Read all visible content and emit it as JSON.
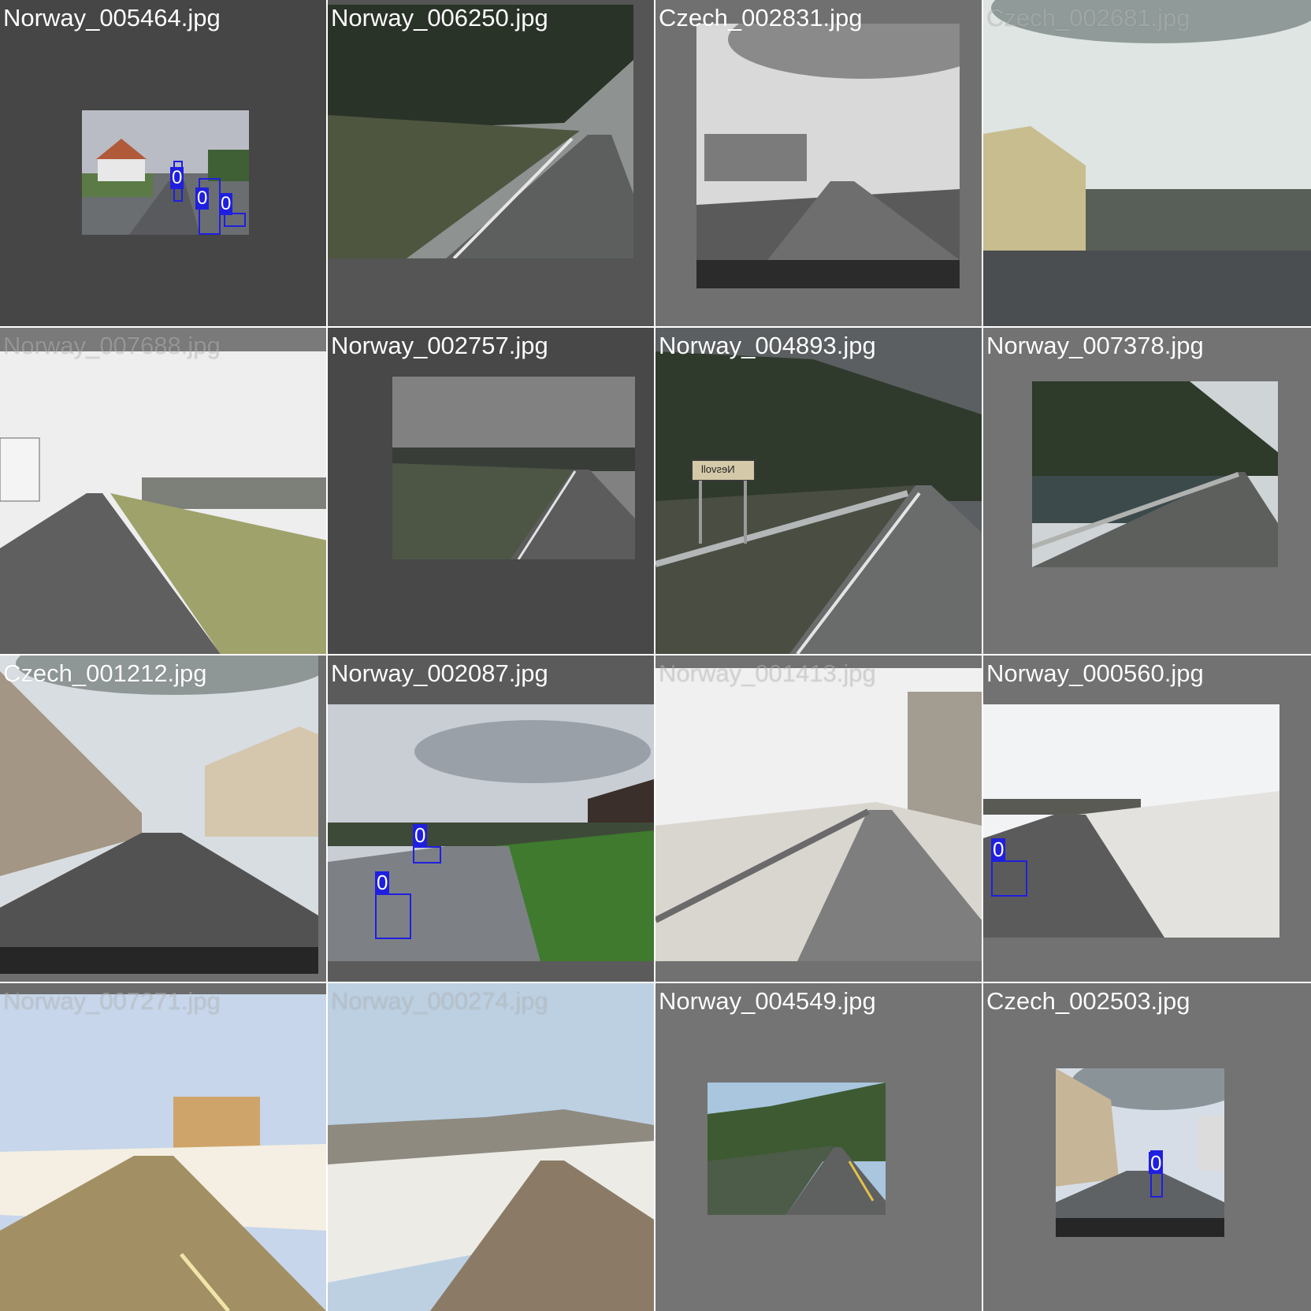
{
  "mosaic": {
    "tiles": [
      {
        "name": "Norway_005464.jpg",
        "class_label": "0"
      },
      {
        "name": "Norway_006250.jpg"
      },
      {
        "name": "Czech_002831.jpg"
      },
      {
        "name": "Czech_002681.jpg"
      },
      {
        "name": "Norway_007688.jpg"
      },
      {
        "name": "Norway_002757.jpg"
      },
      {
        "name": "Norway_004893.jpg",
        "sign_text": "Nesvoll"
      },
      {
        "name": "Norway_007378.jpg"
      },
      {
        "name": "Czech_001212.jpg"
      },
      {
        "name": "Norway_002087.jpg",
        "class_label": "0"
      },
      {
        "name": "Norway_001413.jpg"
      },
      {
        "name": "Norway_000560.jpg",
        "class_label": "0"
      },
      {
        "name": "Norway_007271.jpg"
      },
      {
        "name": "Norway_000274.jpg"
      },
      {
        "name": "Norway_004549.jpg"
      },
      {
        "name": "Czech_002503.jpg",
        "class_label": "0"
      }
    ],
    "colors": {
      "padding_dark": "#444444",
      "padding_mid": "#727272",
      "box": "#1f1fe0",
      "label_text": "#ffffff"
    }
  }
}
